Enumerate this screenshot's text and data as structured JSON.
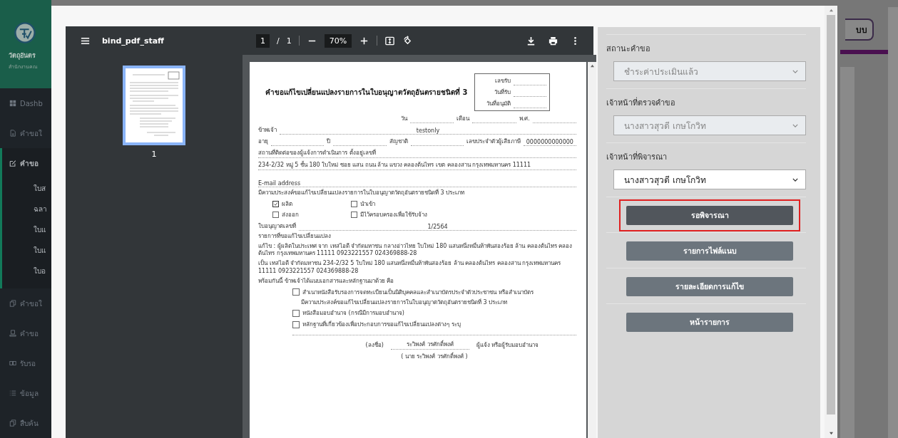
{
  "sidebar": {
    "brand": "วัตถุอันตร",
    "subtitle": "สำนักงานคณ",
    "items": [
      {
        "label": "Dashb",
        "selected": false
      },
      {
        "label": "คำขอใ",
        "selected": false
      },
      {
        "label": "คำขอ",
        "selected": true,
        "children": [
          {
            "label": "ใบส"
          },
          {
            "label": "ฉลา"
          },
          {
            "label": "ใบแ"
          },
          {
            "label": "ใบแ"
          },
          {
            "label": "ใบอ"
          }
        ]
      },
      {
        "label": "คำขอใ",
        "selected": false
      },
      {
        "label": "คำขอ",
        "selected": false
      },
      {
        "label": "รับรอ",
        "selected": false
      },
      {
        "label": "ข้อมูล",
        "selected": false
      },
      {
        "label": "สืบค้น",
        "selected": false
      }
    ]
  },
  "background_button": "บบ",
  "viewer": {
    "file_name": "bind_pdf_staff",
    "page": "1",
    "page_sep": "/",
    "page_count": "1",
    "zoom": "70%",
    "thumbnail_label": "1"
  },
  "document": {
    "title": "คำขอแก้ไขเปลี่ยนแปลงรายการในใบอนุญาตวัตถุอันตรายชนิดที่ 3",
    "box_labels": [
      "เลขรับ",
      "วันที่รับ",
      "วันที่อนุมัติ"
    ],
    "rows": [
      {
        "kind": "date",
        "items": [
          {
            "label": "วัน"
          },
          {
            "label": "เดือน"
          },
          {
            "label": "พ.ศ."
          }
        ]
      },
      {
        "kind": "fields",
        "items": [
          {
            "label": "ข้าพเจ้า",
            "value": "testonly"
          }
        ]
      },
      {
        "kind": "fields",
        "items": [
          {
            "label": "อายุ"
          },
          {
            "label": "ปี"
          },
          {
            "label": "สัญชาติ"
          },
          {
            "label": "เลขประจำตัวผู้เสียภาษี",
            "value": "0000000000000"
          }
        ]
      },
      {
        "kind": "line",
        "text": "สถานที่ติดต่อของผู้แจ้งการดำเนินการ ตั้งอยู่เลขที่"
      },
      {
        "kind": "line",
        "text": "234-2/32 หมู่ 5 ชั้น 180 ใบใหม่ ซอย แสน ถนน ล้าน แขวง คลองต้นไทร เขต คลองสาน กรุงเทพมหานคร 11111"
      },
      {
        "kind": "gap"
      },
      {
        "kind": "line",
        "text": "E-mail address"
      },
      {
        "kind": "text",
        "text": "มีความประสงค์ขอแก้ไขเปลี่ยนแปลงรายการในใบอนุญาตวัตถุอันตรายชนิดที่ 3 ประเภท"
      },
      {
        "kind": "checks",
        "items": [
          {
            "label": "ผลิต",
            "checked": true
          },
          {
            "label": "นำเข้า",
            "checked": false
          },
          {
            "label": "ส่งออก",
            "checked": false
          },
          {
            "label": "มีไว้ครอบครองเพื่อใช้รับจ้าง",
            "checked": false
          }
        ]
      },
      {
        "kind": "fields",
        "items": [
          {
            "label": "ใบอนุญาตเลขที่",
            "value": "1/2564"
          }
        ]
      },
      {
        "kind": "text",
        "text": "รายการที่ขอแก้ไขเปลี่ยนแปลง"
      },
      {
        "kind": "text",
        "text": "แก้ไข : ผู้ผลิตในประเทศ จาก เทสไอดี จำกัดมหาชน กลางอ่าวไทย ใบใหม่ 180 แสนหนึ่งหมื่นห้าพันสองร้อย ล้าน คลองต้นไทร คลองต้นไทร กรุงเทพมหานคร 11111 0923221557 024369888-28"
      },
      {
        "kind": "text",
        "text": "เป็น เทสไอดี จำกัดมหาชน 234-2/32 5 ใบใหม่ 180 แสนหนึ่งหมื่นห้าพันสองร้อย ล้าน คลองต้นไทร คลองสาน กรุงเทพมหานคร 11111 0923221557 024369888-28"
      },
      {
        "kind": "text",
        "text": "พร้อมกันนี้ ข้าพเจ้าได้แนบเอกสารและหลักฐานมาด้วย คือ"
      },
      {
        "kind": "attach",
        "items": [
          {
            "label": "สำเนาหนังสือรับรองการจดทะเบียนเป็นนิติบุคคลและสำเนาบัตรประจำตัวประชาชน หรือสำเนาบัตร",
            "checked": false
          }
        ]
      },
      {
        "kind": "indent",
        "text": "มีความประสงค์ขอแก้ไขเปลี่ยนแปลงรายการในใบอนุญาตวัตถุอันตรายชนิดที่ 3 ประเภท"
      },
      {
        "kind": "attach",
        "items": [
          {
            "label": "หนังสือมอบอำนาจ (กรณีมีการมอบอำนาจ)",
            "checked": false
          },
          {
            "label": "หลักฐานที่เกี่ยวข้องเพื่อประกอบการขอแก้ไขเปลี่ยนแปลงต่างๆ ระบุ",
            "checked": false
          }
        ]
      },
      {
        "kind": "signature",
        "sign_label": "(ลงชื่อ)",
        "signer": "ระวิพงศ์ วรศักดิ์พงศ์",
        "role": "ผู้แจ้ง หรือผู้รับมอบอำนาจ",
        "full_name": "( นาย ระวิพงศ์ วรศักดิ์พงศ์ )"
      }
    ]
  },
  "panel": {
    "fields": [
      {
        "label": "สถานะคำขอ",
        "value": "ชำระค่าประเมินแล้ว",
        "disabled": true
      },
      {
        "label": "เจ้าหน้าที่ตรวจคำขอ",
        "value": "นางสาวสุวดี เกษโกวิท",
        "disabled": true
      },
      {
        "label": "เจ้าหน้าที่พิจารณา",
        "value": "นางสาวสุวดี เกษโกวิท",
        "disabled": false
      }
    ],
    "buttons": [
      {
        "label": "รอพิจารณา",
        "kind": "primary",
        "highlighted": true
      },
      {
        "label": "รายการไฟล์แนบ",
        "kind": "secondary",
        "highlighted": false
      },
      {
        "label": "รายละเอียดการแก้ไข",
        "kind": "secondary",
        "highlighted": false
      },
      {
        "label": "หน้ารายการ",
        "kind": "secondary",
        "highlighted": false
      }
    ]
  }
}
